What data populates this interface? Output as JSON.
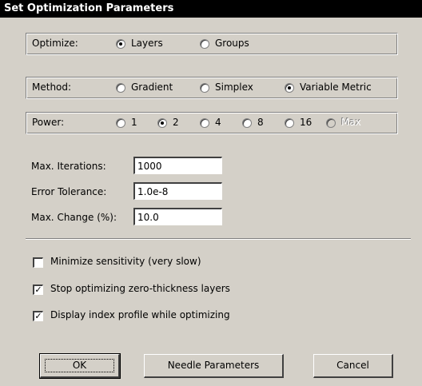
{
  "dialog": {
    "title": "Set Optimization Parameters"
  },
  "optimize": {
    "label": "Optimize:",
    "options": [
      {
        "label": "Layers",
        "checked": true
      },
      {
        "label": "Groups",
        "checked": false
      }
    ]
  },
  "method": {
    "label": "Method:",
    "options": [
      {
        "label": "Gradient",
        "checked": false
      },
      {
        "label": "Simplex",
        "checked": false
      },
      {
        "label": "Variable Metric",
        "checked": true
      }
    ]
  },
  "power": {
    "label": "Power:",
    "options": [
      {
        "label": "1",
        "checked": false,
        "disabled": false
      },
      {
        "label": "2",
        "checked": true,
        "disabled": false
      },
      {
        "label": "4",
        "checked": false,
        "disabled": false
      },
      {
        "label": "8",
        "checked": false,
        "disabled": false
      },
      {
        "label": "16",
        "checked": false,
        "disabled": false
      },
      {
        "label": "Max",
        "checked": false,
        "disabled": true
      }
    ]
  },
  "fields": {
    "max_iterations": {
      "label": "Max. Iterations:",
      "value": "1000"
    },
    "error_tolerance": {
      "label": "Error Tolerance:",
      "value": "1.0e-8"
    },
    "max_change": {
      "label": "Max. Change (%):",
      "value": "10.0"
    }
  },
  "checkboxes": [
    {
      "label": "Minimize sensitivity (very slow)",
      "checked": false
    },
    {
      "label": "Stop optimizing zero-thickness layers",
      "checked": true
    },
    {
      "label": "Display index profile while optimizing",
      "checked": true
    }
  ],
  "buttons": {
    "ok": "OK",
    "needle": "Needle Parameters",
    "cancel": "Cancel"
  }
}
